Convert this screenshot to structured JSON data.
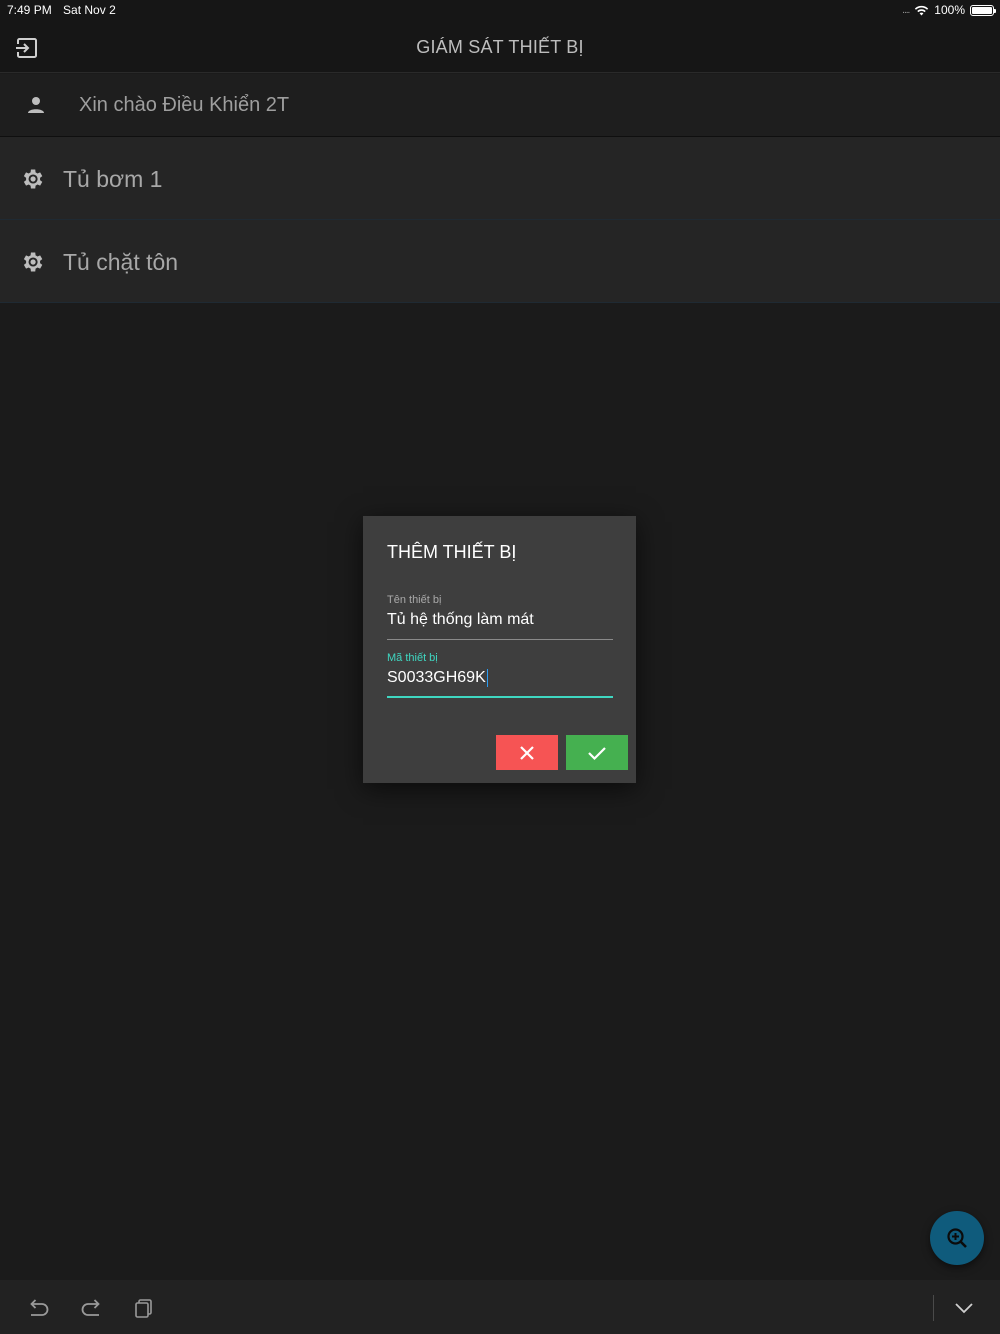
{
  "status_bar": {
    "time": "7:49 PM",
    "date": "Sat Nov 2",
    "signal_dots": "....",
    "battery_text": "100%",
    "wifi_icon": "wifi-icon",
    "battery_icon": "battery-icon"
  },
  "header": {
    "title": "GIÁM SÁT THIẾT BỊ",
    "logout_icon": "logout-icon"
  },
  "greeting": {
    "text": "Xin chào Điều Khiển 2T",
    "icon": "user-icon"
  },
  "devices": [
    {
      "label": "Tủ bơm 1",
      "icon": "gear-icon"
    },
    {
      "label": "Tủ chặt tôn",
      "icon": "gear-icon"
    }
  ],
  "dialog": {
    "title": "THÊM THIẾT BỊ",
    "fields": [
      {
        "label": "Tên thiết bị",
        "value": "Tủ hệ thống làm mát"
      },
      {
        "label": "Mã thiết bị",
        "value": "S0033GH69K"
      }
    ],
    "cancel_icon": "close-icon",
    "confirm_icon": "check-icon",
    "colors": {
      "cancel": "#f65454",
      "confirm": "#45b050",
      "focus_accent": "#3fd7c1"
    }
  },
  "fab": {
    "icon": "zoom-in-icon",
    "color": "#0f5b7c"
  },
  "bottom_toolbar": {
    "icons": [
      "undo-icon",
      "redo-icon",
      "paste-icon",
      "chevron-down-icon"
    ]
  }
}
